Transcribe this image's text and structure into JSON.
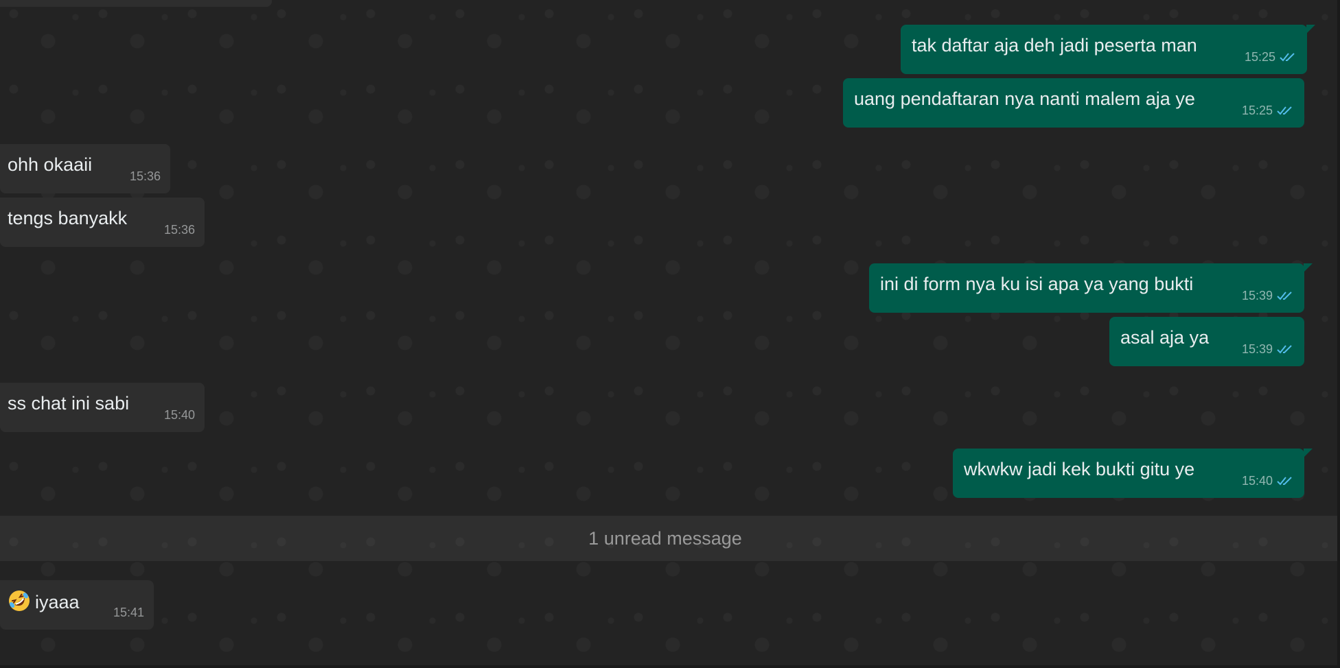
{
  "messages": [
    {
      "id": "m1",
      "direction": "out",
      "text": "tak daftar aja deh jadi peserta man",
      "time": "15:25",
      "status": "read"
    },
    {
      "id": "m2",
      "direction": "out",
      "text": "uang pendaftaran nya nanti malem aja ye",
      "time": "15:25",
      "status": "read"
    },
    {
      "id": "m3",
      "direction": "in",
      "text": "ohh okaaii",
      "time": "15:36"
    },
    {
      "id": "m4",
      "direction": "in",
      "text": "tengs banyakk",
      "time": "15:36"
    },
    {
      "id": "m5",
      "direction": "out",
      "text": "ini di form nya ku isi apa ya yang bukti",
      "time": "15:39",
      "status": "read"
    },
    {
      "id": "m6",
      "direction": "out",
      "text": "asal aja ya",
      "time": "15:39",
      "status": "read"
    },
    {
      "id": "m7",
      "direction": "in",
      "text": "ss chat ini sabi",
      "time": "15:40"
    },
    {
      "id": "m8",
      "direction": "out",
      "text": "wkwkw jadi kek bukti gitu ye",
      "time": "15:40",
      "status": "read"
    },
    {
      "id": "m9",
      "direction": "in",
      "emoji": "rolling-on-the-floor-laughing",
      "text": "iyaaa",
      "time": "15:41"
    }
  ],
  "unread_divider": "1 unread message",
  "colors": {
    "background": "#232323",
    "incoming_bubble": "#2e2e2e",
    "outgoing_bubble": "#005c4b",
    "read_ticks": "#53bdeb"
  }
}
